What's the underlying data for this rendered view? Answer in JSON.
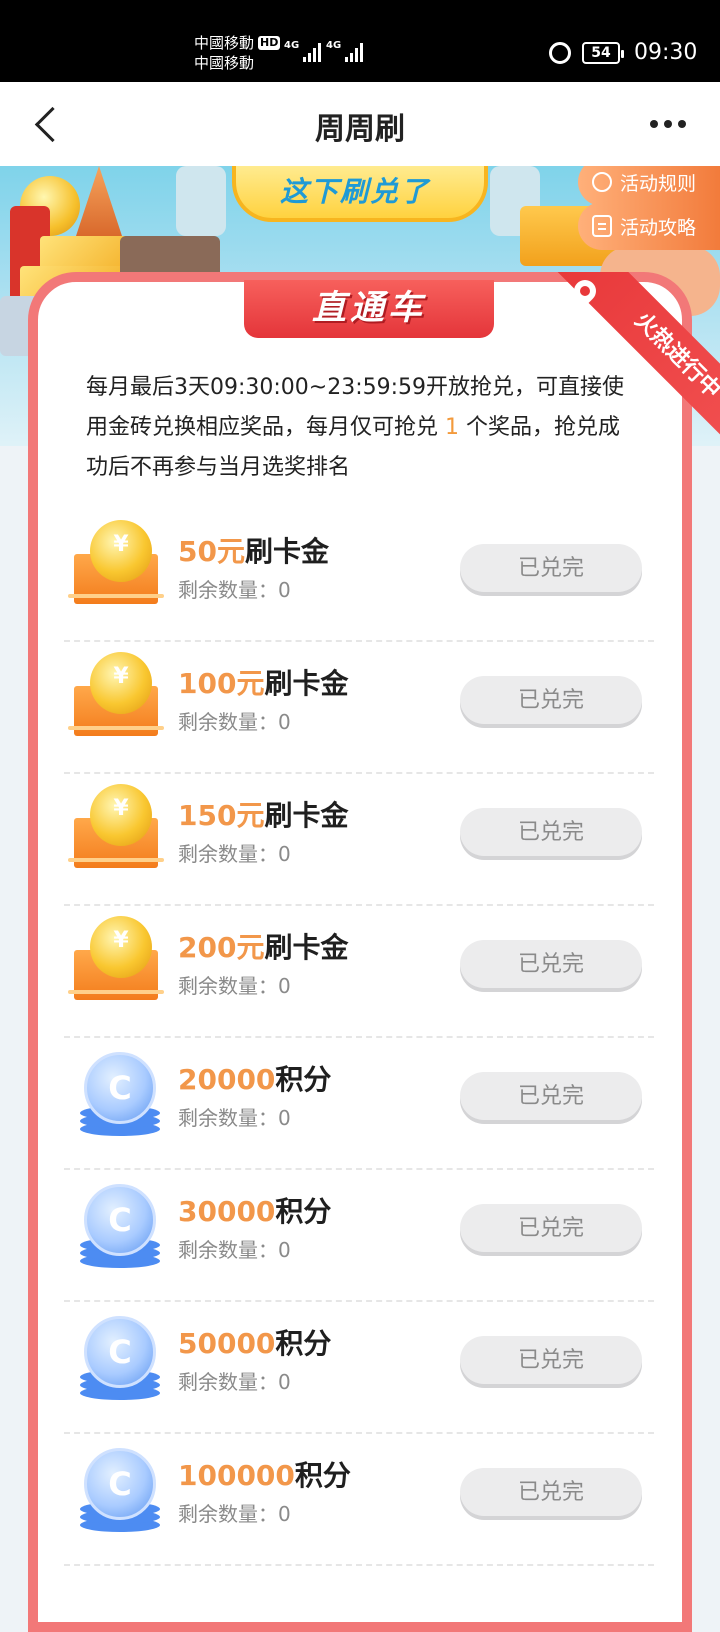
{
  "status": {
    "carrier1": "中國移動",
    "carrier1_tag": "HD",
    "carrier2": "中國移動",
    "net1": "4G",
    "net2": "4G",
    "battery": "54",
    "time": "09:30"
  },
  "nav": {
    "title": "周周刷"
  },
  "banner": {
    "headline": "这下刷兑了",
    "rules_button": "活动规则",
    "guide_button": "活动攻略"
  },
  "card": {
    "tab_title": "直通车",
    "ribbon": "火热进行中",
    "desc_before": "每月最后3天09:30:00~23:59:59开放抢兑，可直接使用金砖兑换相应奖品，每月仅可抢兑",
    "desc_count": "1",
    "desc_after": "个奖品，抢兑成功后不再参与当月选奖排名"
  },
  "prizes": [
    {
      "icon": "gift-coin-icon",
      "amount": "50元",
      "name": "刷卡金",
      "remain_label": "剩余数量：",
      "remain": "0",
      "button": "已兑完"
    },
    {
      "icon": "gift-coin-icon",
      "amount": "100元",
      "name": "刷卡金",
      "remain_label": "剩余数量：",
      "remain": "0",
      "button": "已兑完"
    },
    {
      "icon": "gift-coin-icon",
      "amount": "150元",
      "name": "刷卡金",
      "remain_label": "剩余数量：",
      "remain": "0",
      "button": "已兑完"
    },
    {
      "icon": "gift-coin-icon",
      "amount": "200元",
      "name": "刷卡金",
      "remain_label": "剩余数量：",
      "remain": "0",
      "button": "已兑完"
    },
    {
      "icon": "points-coin-icon",
      "amount": "20000",
      "name": "积分",
      "remain_label": "剩余数量：",
      "remain": "0",
      "button": "已兑完"
    },
    {
      "icon": "points-coin-icon",
      "amount": "30000",
      "name": "积分",
      "remain_label": "剩余数量：",
      "remain": "0",
      "button": "已兑完"
    },
    {
      "icon": "points-coin-icon",
      "amount": "50000",
      "name": "积分",
      "remain_label": "剩余数量：",
      "remain": "0",
      "button": "已兑完"
    },
    {
      "icon": "points-coin-icon",
      "amount": "100000",
      "name": "积分",
      "remain_label": "剩余数量：",
      "remain": "0",
      "button": "已兑完"
    }
  ],
  "colors": {
    "accent_orange": "#f2974a",
    "card_border": "#f27878",
    "tab_red": "#e4353a",
    "disabled_button": "#ececed"
  }
}
